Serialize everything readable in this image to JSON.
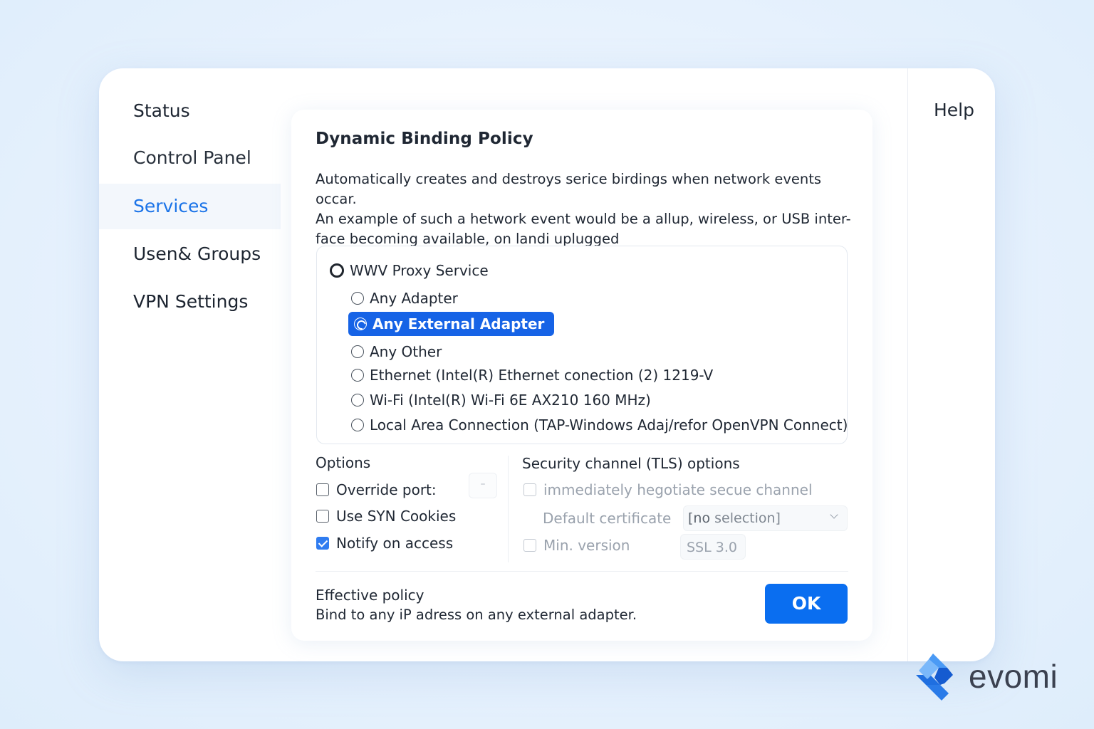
{
  "sidebar": {
    "items": [
      {
        "label": "Status"
      },
      {
        "label": "Control Panel"
      },
      {
        "label": "Services"
      },
      {
        "label": "Usen& Groups"
      },
      {
        "label": "VPN Settings"
      }
    ],
    "active": "Services"
  },
  "help": {
    "label": "Help"
  },
  "policy": {
    "title": "Dynamic Binding Policy",
    "description_lines": [
      "Automatically creates and destroys serice birdings when network events occar.",
      "An example of such a hetwork event would be a allup, wireless, or USB inter-",
      "face becoming available, on landi uplugged"
    ],
    "service": {
      "label": "WWV Proxy Service"
    },
    "adapters": [
      {
        "label": "Any Adapter",
        "selected": false
      },
      {
        "label": "Any External Adapter",
        "selected": true
      },
      {
        "label": "Any Other",
        "selected": false
      },
      {
        "label": "Ethernet (Intel(R) Ethernet conection (2) 1219-V",
        "selected": false
      },
      {
        "label": "Wi-Fi (Intel(R) Wi-Fi 6E AX210 160 MHz)",
        "selected": false
      },
      {
        "label": "Local Area Connection (TAP-Windows Adaj/refor OpenVPN Connect)",
        "selected": false
      }
    ]
  },
  "options": {
    "title": "Options",
    "override_port": {
      "label": "Override port:",
      "checked": false
    },
    "port_value": "–",
    "syn_cookies": {
      "label": "Use SYN Cookies",
      "checked": false
    },
    "notify": {
      "label": "Notify on access",
      "checked": true
    }
  },
  "tls": {
    "title": "Security channel (TLS) options",
    "negotiate": {
      "label": "immediately hegotiate secue channel",
      "checked": false
    },
    "default_cert_label": "Default certificate",
    "default_cert_value_prefix": "[no",
    "default_cert_value_rest": " selection]",
    "min_version": {
      "label": "Min. version",
      "checked": false
    },
    "min_version_value": "SSL 3.0"
  },
  "effective": {
    "title": "Effective policy",
    "text": "Bind to any iP adress on any external adapter."
  },
  "ok_button": {
    "label": "OK"
  },
  "brand": {
    "name": "evomi"
  },
  "colors": {
    "accent": "#0a6ef0",
    "selected_bg": "#1663e6",
    "active_nav": "#1a73e8"
  }
}
